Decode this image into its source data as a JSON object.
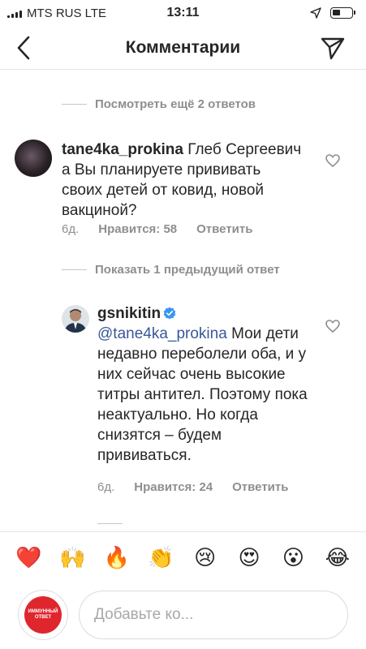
{
  "status_bar": {
    "carrier": "MTS RUS  LTE",
    "time": "13:11",
    "battery_level": 0.45
  },
  "header": {
    "title": "Комментарии"
  },
  "replies_links": {
    "view_more": "Посмотреть ещё 2 ответов",
    "show_previous": "Показать 1 предыдущий ответ"
  },
  "comments": [
    {
      "username": "tane4ka_prokina",
      "text": "Глеб Сергеевич а Вы планируете прививать своих детей от ковид, новой вакциной?",
      "age": "6д.",
      "likes": "Нравится: 58",
      "reply": "Ответить"
    },
    {
      "username": "gsnikitin",
      "verified": true,
      "mention": "@tane4ka_prokina",
      "text": "Мои дети недавно переболели оба, и у них сейчас очень высокие титры антител. Поэтому пока неактуально. Но когда снизятся – будем прививаться.",
      "age": "6д.",
      "likes": "Нравится: 24",
      "reply": "Ответить"
    }
  ],
  "emoji_bar": [
    "❤️",
    "🙌",
    "🔥",
    "👏",
    "😢",
    "😍",
    "😮",
    "😂"
  ],
  "composer": {
    "avatar_text": "ИММУННЫЙ ОТВЕТ",
    "placeholder": "Добавьте ко..."
  },
  "colors": {
    "text": "#262626",
    "secondary": "#8e8e8e",
    "mention": "#385898",
    "verified": "#3897f0",
    "brand_red": "#e0262d"
  }
}
